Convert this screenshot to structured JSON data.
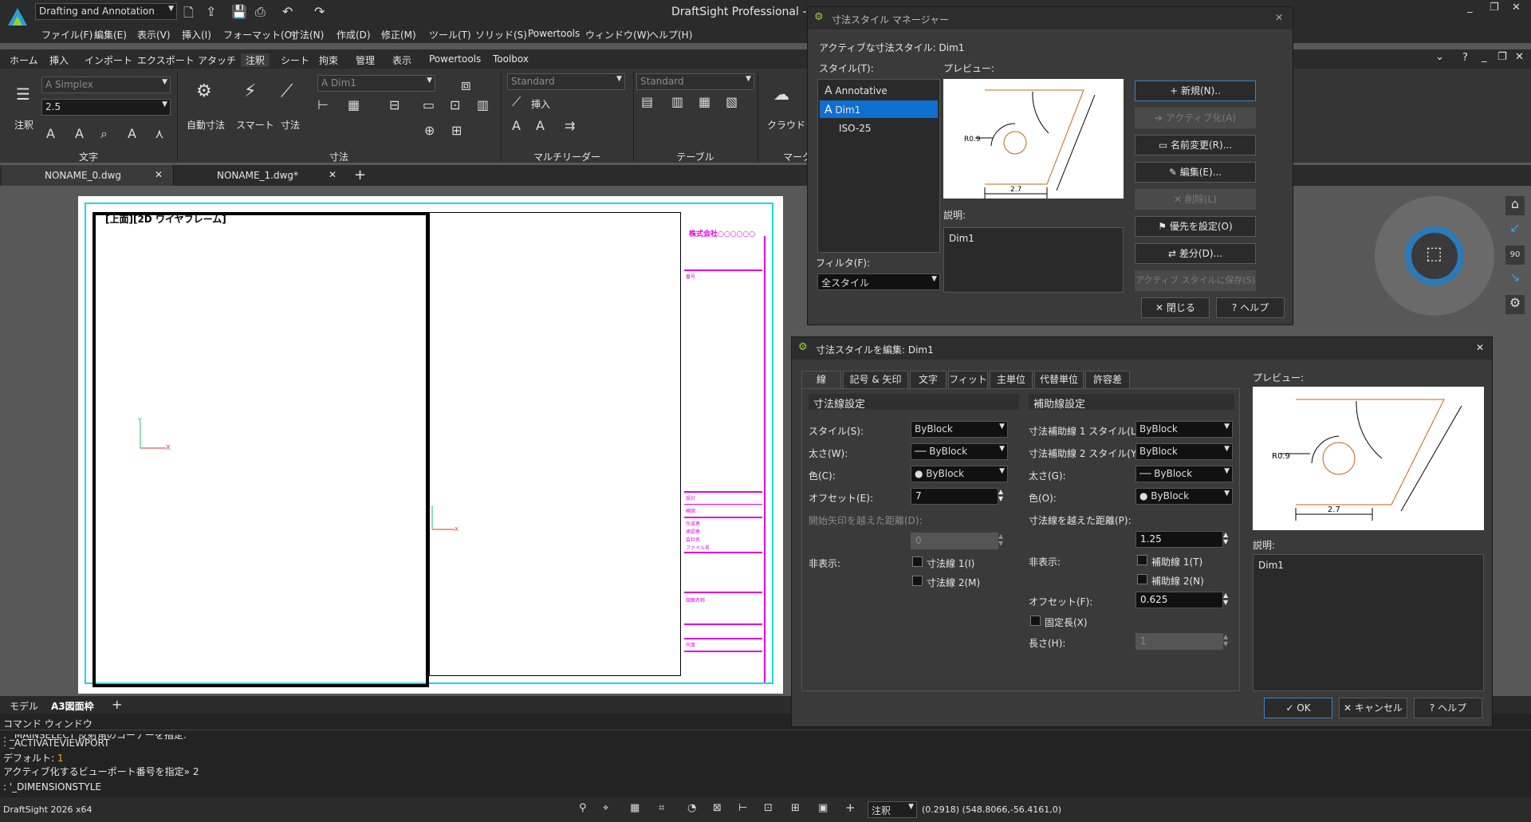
{
  "app": {
    "title": "DraftSight Professional - [",
    "workspace": "Drafting and Annotation",
    "window_controls": [
      "_",
      "❐",
      "✕"
    ]
  },
  "menu": [
    "ファイル(F)",
    "編集(E)",
    "表示(V)",
    "挿入(I)",
    "フォーマット(O)",
    "寸法(N)",
    "作成(D)",
    "修正(M)",
    "ツール(T)",
    "ソリッド(S)",
    "Powertools",
    "ウィンドウ(W)",
    "ヘルプ(H)"
  ],
  "ribbon_tabs": [
    "ホーム",
    "挿入",
    "インポート",
    "エクスポート",
    "アタッチ",
    "注釈",
    "シート",
    "拘束",
    "管理",
    "表示",
    "Powertools",
    "Toolbox"
  ],
  "ribbon": {
    "text_font": "Simplex",
    "text_height": "2.5",
    "annotate_label": "注釈",
    "text_section": "文字",
    "auto_dim_label": "自動寸法",
    "smart_label": "スマート",
    "dim_label": "寸法",
    "dim_style": "Dim1",
    "dim_section": "寸法",
    "leader_style": "Standard",
    "leader_insert": "挿入",
    "leader_section": "マルチリーダー",
    "table_style": "Standard",
    "table_section": "テーブル",
    "cloud_label": "クラウド",
    "markup_section": "マークア"
  },
  "doc_tabs": [
    {
      "label": "NONAME_0.dwg",
      "close": "✕"
    },
    {
      "label": "NONAME_1.dwg*",
      "close": "✕"
    }
  ],
  "add_tab": "+",
  "drawing": {
    "viewport_label": "[上面][2D ワイヤフレーム]",
    "company": "株式会社○○○○○○",
    "title_rows": [
      "番号",
      "設計",
      "検図",
      "作成者",
      "承認者",
      "会社名",
      "ファイル名",
      "図面名称",
      "尺度"
    ]
  },
  "sheet_tabs": [
    "モデル",
    "A3図面枠"
  ],
  "dim_manager": {
    "title": "寸法スタイル マネージャー",
    "active_label": "アクティブな寸法スタイル: Dim1",
    "styles_label": "スタイル(T):",
    "styles": [
      "Annotative",
      "Dim1",
      "ISO-25"
    ],
    "selected": "Dim1",
    "preview_label": "プレビュー:",
    "desc_label": "説明:",
    "desc_value": "Dim1",
    "filter_label": "フィルタ(F):",
    "filter_value": "全スタイル",
    "buttons": {
      "new": "新規(N)..",
      "activate": "アクティブ化(A)",
      "rename": "名前変更(R)...",
      "edit": "編集(E)...",
      "delete": "削除(L)",
      "override": "優先を設定(O)",
      "compare": "差分(D)...",
      "save": "アクティブ スタイルに保存(S)",
      "close": "閉じる",
      "help": "ヘルプ"
    }
  },
  "preview": {
    "radius": "R0.9",
    "length": "2.7"
  },
  "edit_dialog": {
    "title": "寸法スタイルを編集: Dim1",
    "tabs": [
      "線",
      "記号 & 矢印",
      "文字",
      "フィット",
      "主単位",
      "代替単位",
      "許容差"
    ],
    "dim_lines": {
      "header": "寸法線設定",
      "style_label": "スタイル(S):",
      "style_value": "ByBlock",
      "weight_label": "太さ(W):",
      "weight_value": "ByBlock",
      "color_label": "色(C):",
      "color_value": "ByBlock",
      "offset_label": "オフセット(E):",
      "offset_value": "7",
      "beyond_label": "開始矢印を越えた距離(D):",
      "beyond_value": "0",
      "hide_label": "非表示:",
      "hide1": "寸法線 1(I)",
      "hide2": "寸法線 2(M)"
    },
    "ext_lines": {
      "header": "補助線設定",
      "style1_label": "寸法補助線 1 スタイル(L):",
      "style1_value": "ByBlock",
      "style2_label": "寸法補助線 2 スタイル(Y):",
      "style2_value": "ByBlock",
      "weight_label": "太さ(G):",
      "weight_value": "ByBlock",
      "color_label": "色(O):",
      "color_value": "ByBlock",
      "beyond_label": "寸法線を越えた距離(P):",
      "beyond_value": "1.25",
      "hide_label": "非表示:",
      "hide1": "補助線 1(T)",
      "hide2": "補助線 2(N)",
      "offset_label": "オフセット(F):",
      "offset_value": "0.625",
      "fixed_label": "固定長(X)",
      "length_label": "長さ(H):",
      "length_value": "1"
    },
    "preview_label": "プレビュー:",
    "desc_label": "説明:",
    "desc_value": "Dim1",
    "ok": "OK",
    "cancel": "キャンセル",
    "help": "ヘルプ"
  },
  "command": {
    "title": "コマンド ウィンドウ",
    "lines": [
      ": _MAINSELECT 反射角のコーナーを指定:",
      ": _ACTIVATEVIEWPORT",
      "デフォルト: ",
      "アクティブ化するビューポート番号を指定» 2",
      ": '_DIMENSIONSTYLE"
    ],
    "default_value": "1"
  },
  "status": {
    "app": "DraftSight 2026 x64",
    "annotation": "注釈",
    "coords": "(0.2918)  (548.8066,-56.4161,0)"
  },
  "nav": {
    "angle": "90"
  },
  "colors": {
    "accent": "#3a80d0",
    "magenta": "#e000e0",
    "cyan": "#00d0e0",
    "selected": "#0f6fd0"
  }
}
